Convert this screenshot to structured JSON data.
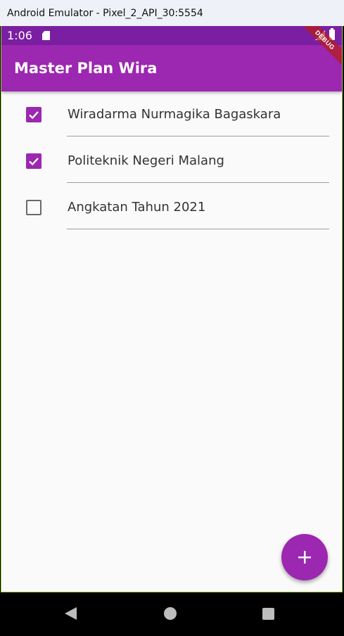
{
  "window": {
    "title": "Android Emulator - Pixel_2_API_30:5554"
  },
  "status_bar": {
    "time": "1:06",
    "icons": [
      "sd-card-icon",
      "signal-icon",
      "battery-icon"
    ]
  },
  "debug_banner": "DEBUG",
  "app_bar": {
    "title": "Master Plan Wira"
  },
  "tasks": [
    {
      "label": "Wiradarma Nurmagika Bagaskara",
      "checked": true
    },
    {
      "label": "Politeknik Negeri Malang",
      "checked": true
    },
    {
      "label": "Angkatan Tahun 2021",
      "checked": false
    }
  ],
  "fab": {
    "icon": "plus-icon"
  },
  "nav": {
    "icons": [
      "back-icon",
      "home-icon",
      "recents-icon"
    ]
  },
  "colors": {
    "primary": "#9c27b0",
    "primary_dark": "#7b1fa2",
    "background": "#fafafa"
  }
}
